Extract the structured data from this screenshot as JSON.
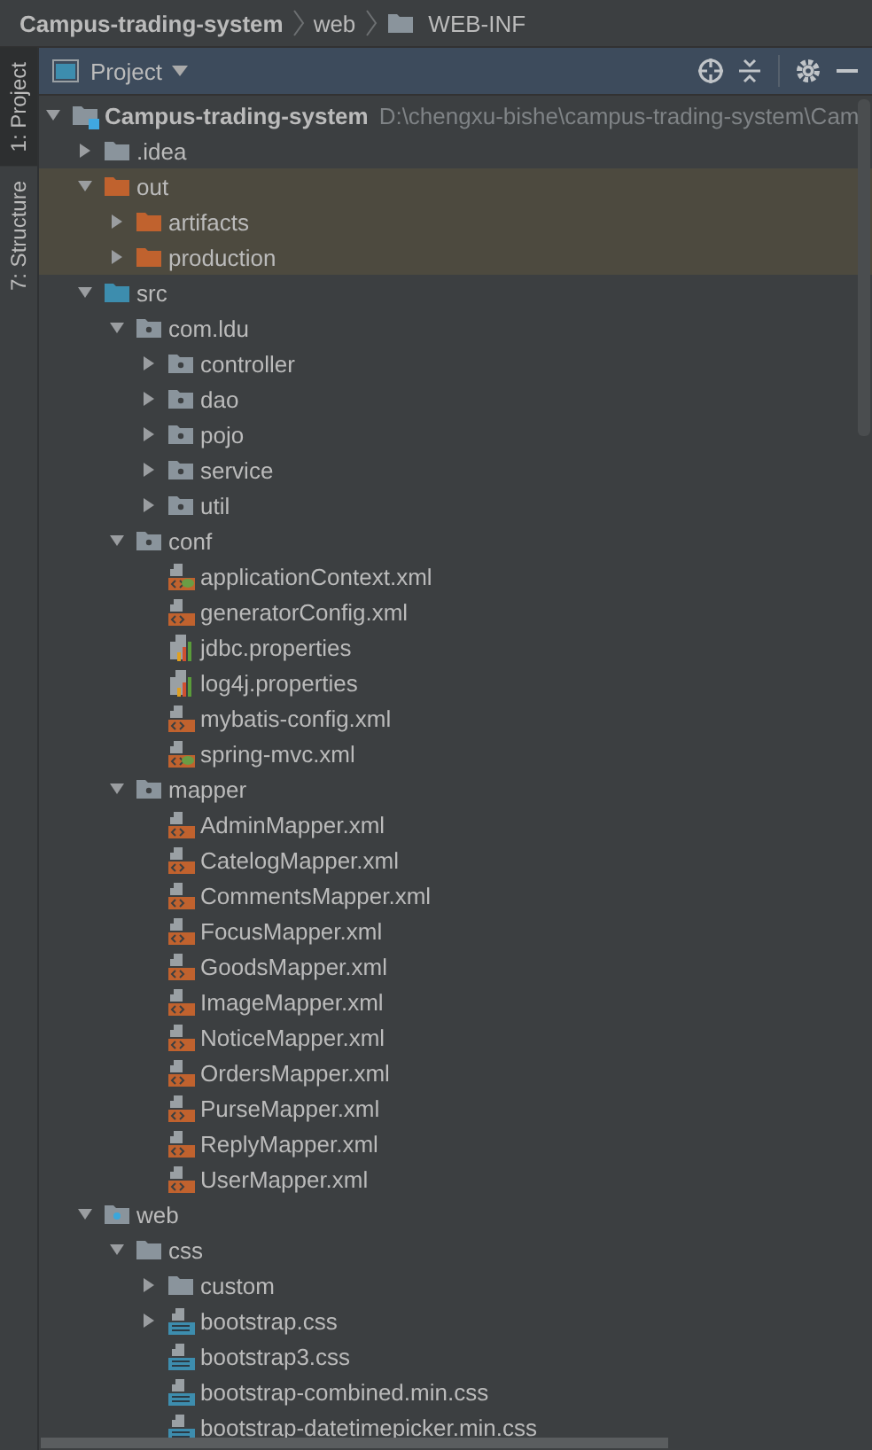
{
  "breadcrumb": [
    {
      "label": "Campus-trading-system",
      "kind": "module"
    },
    {
      "label": "web",
      "kind": "plain"
    },
    {
      "label": "WEB-INF",
      "kind": "folder"
    }
  ],
  "tool_strip": [
    {
      "label": "1: Project",
      "selected": true
    },
    {
      "label": "7: Structure",
      "selected": false
    }
  ],
  "panel": {
    "title": "Project"
  },
  "tree": [
    {
      "label": "Campus-trading-system",
      "kind": "module",
      "path": "D:\\chengxu-bishe\\campus-trading-system\\Cam",
      "expanded": true,
      "children": [
        {
          "label": ".idea",
          "kind": "folder",
          "expanded": false
        },
        {
          "label": "out",
          "kind": "excluded",
          "expanded": true,
          "children": [
            {
              "label": "artifacts",
              "kind": "excluded",
              "expanded": false
            },
            {
              "label": "production",
              "kind": "excluded",
              "expanded": false
            }
          ]
        },
        {
          "label": "src",
          "kind": "source",
          "expanded": true,
          "children": [
            {
              "label": "com.ldu",
              "kind": "package",
              "expanded": true,
              "children": [
                {
                  "label": "controller",
                  "kind": "package",
                  "expanded": false
                },
                {
                  "label": "dao",
                  "kind": "package",
                  "expanded": false
                },
                {
                  "label": "pojo",
                  "kind": "package",
                  "expanded": false
                },
                {
                  "label": "service",
                  "kind": "package",
                  "expanded": false
                },
                {
                  "label": "util",
                  "kind": "package",
                  "expanded": false
                }
              ]
            },
            {
              "label": "conf",
              "kind": "package",
              "expanded": true,
              "children": [
                {
                  "label": "applicationContext.xml",
                  "kind": "spring"
                },
                {
                  "label": "generatorConfig.xml",
                  "kind": "xml"
                },
                {
                  "label": "jdbc.properties",
                  "kind": "properties"
                },
                {
                  "label": "log4j.properties",
                  "kind": "properties"
                },
                {
                  "label": "mybatis-config.xml",
                  "kind": "xml"
                },
                {
                  "label": "spring-mvc.xml",
                  "kind": "spring"
                }
              ]
            },
            {
              "label": "mapper",
              "kind": "package",
              "expanded": true,
              "children": [
                {
                  "label": "AdminMapper.xml",
                  "kind": "xml"
                },
                {
                  "label": "CatelogMapper.xml",
                  "kind": "xml"
                },
                {
                  "label": "CommentsMapper.xml",
                  "kind": "xml"
                },
                {
                  "label": "FocusMapper.xml",
                  "kind": "xml"
                },
                {
                  "label": "GoodsMapper.xml",
                  "kind": "xml"
                },
                {
                  "label": "ImageMapper.xml",
                  "kind": "xml"
                },
                {
                  "label": "NoticeMapper.xml",
                  "kind": "xml"
                },
                {
                  "label": "OrdersMapper.xml",
                  "kind": "xml"
                },
                {
                  "label": "PurseMapper.xml",
                  "kind": "xml"
                },
                {
                  "label": "ReplyMapper.xml",
                  "kind": "xml"
                },
                {
                  "label": "UserMapper.xml",
                  "kind": "xml"
                }
              ]
            }
          ]
        },
        {
          "label": "web",
          "kind": "web",
          "expanded": true,
          "children": [
            {
              "label": "css",
              "kind": "folder",
              "expanded": true,
              "children": [
                {
                  "label": "custom",
                  "kind": "folder",
                  "expanded": false
                },
                {
                  "label": "bootstrap.css",
                  "kind": "css",
                  "expanded": false
                },
                {
                  "label": "bootstrap3.css",
                  "kind": "css"
                },
                {
                  "label": "bootstrap-combined.min.css",
                  "kind": "css"
                },
                {
                  "label": "bootstrap-datetimepicker.min.css",
                  "kind": "css"
                }
              ]
            }
          ]
        }
      ]
    }
  ]
}
